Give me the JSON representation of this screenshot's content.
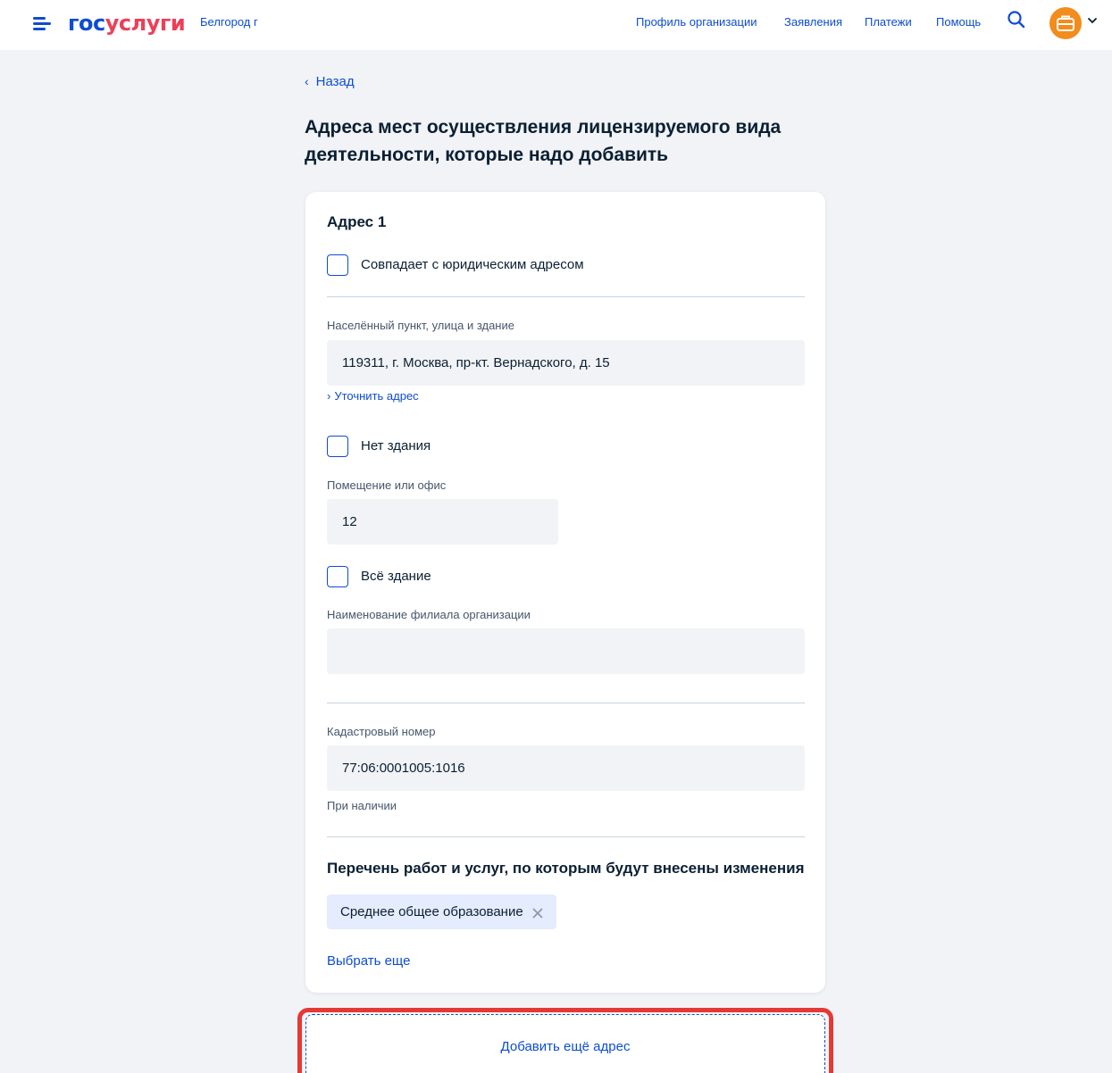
{
  "header": {
    "logo_part1": "гос",
    "logo_part2": "услуги",
    "region": "Белгород г",
    "nav": [
      "Профиль организации",
      "Заявления",
      "Платежи",
      "Помощь"
    ],
    "icons": {
      "menu": "burger-menu-icon",
      "search": "search-icon",
      "avatar": "briefcase-icon",
      "dropdown": "chevron-down-icon"
    }
  },
  "back_label": "Назад",
  "page_title": "Адреса мест осуществления лицензируемого вида деятельности, которые надо добавить",
  "address": {
    "title": "Адрес 1",
    "same_as_legal_label": "Совпадает с юридическим адресом",
    "locality_label": "Населённый пункт, улица и здание",
    "locality_value": "119311, г. Москва, пр-кт. Вернадского, д. 15",
    "refine_link": "Уточнить адрес",
    "no_building_label": "Нет здания",
    "room_label": "Помещение или офис",
    "room_value": "12",
    "whole_building_label": "Всё здание",
    "branch_label": "Наименование филиала организации",
    "branch_value": "",
    "cadastral_label": "Кадастровый номер",
    "cadastral_value": "77:06:0001005:1016",
    "cadastral_hint": "При наличии",
    "services_title": "Перечень работ и услуг, по которым будут внесены изменения",
    "services": [
      "Среднее общее образование"
    ],
    "choose_more": "Выбрать еще"
  },
  "add_address_label": "Добавить ещё адрес",
  "colors": {
    "primary": "#0d4cd3",
    "logo_red": "#ee3f58",
    "avatar": "#f28c1c",
    "highlight": "#e53935",
    "background": "#f1f3f6"
  }
}
